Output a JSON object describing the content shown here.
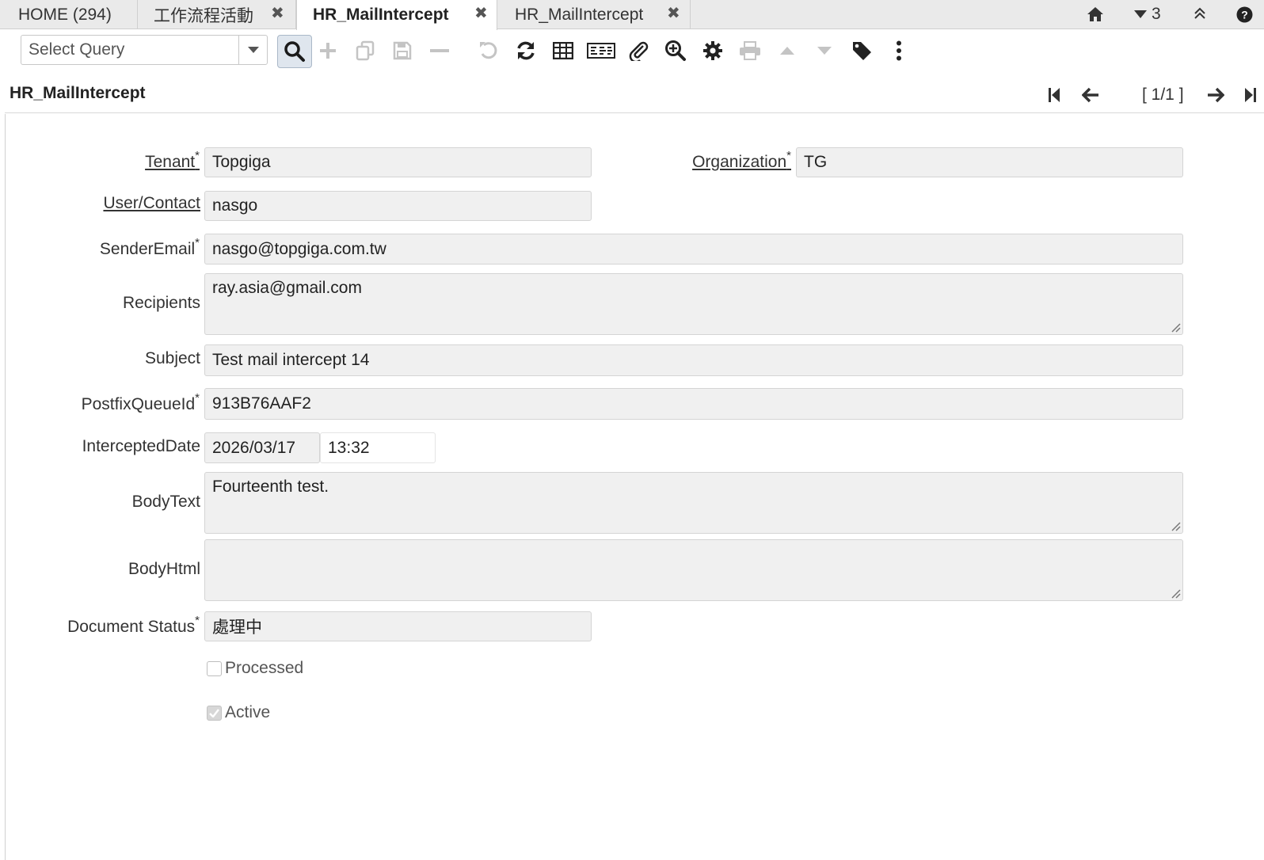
{
  "tabs": {
    "home": "HOME (294)",
    "workflow": "工作流程活動",
    "hr_active": "HR_MailIntercept",
    "hr_second": "HR_MailIntercept",
    "close_glyph": "✖"
  },
  "strip": {
    "window_count": "3",
    "icons": [
      "home-icon",
      "caret-down-icon",
      "double-chevron-up-icon",
      "help-icon"
    ]
  },
  "toolbar": {
    "select_query_placeholder": "Select Query",
    "icons": [
      "search-icon",
      "new-icon",
      "copy-icon",
      "save-icon",
      "delete-icon",
      "undo-icon",
      "refresh-icon",
      "grid-toggle-icon",
      "report-icon",
      "attachment-icon",
      "zoom-icon",
      "process-icon",
      "print-icon",
      "parent-record-icon",
      "detail-record-icon",
      "label-icon",
      "more-icon"
    ]
  },
  "titlebar": {
    "title": "HR_MailIntercept",
    "record_indicator": "[ 1/1 ]"
  },
  "form": {
    "tenant_label": "Tenant",
    "tenant_value": "Topgiga",
    "organization_label": "Organization",
    "organization_value": "TG",
    "user_label": "User/Contact",
    "user_value": "nasgo",
    "sender_label": "SenderEmail",
    "sender_value": "nasgo@topgiga.com.tw",
    "recipients_label": "Recipients",
    "recipients_value": "ray.asia@gmail.com",
    "subject_label": "Subject",
    "subject_value": "Test mail intercept 14",
    "queue_label": "PostfixQueueId",
    "queue_value": "913B76AAF2",
    "intercepted_label": "InterceptedDate",
    "intercepted_date": "2026/03/17",
    "intercepted_time": "13:32",
    "bodytext_label": "BodyText",
    "bodytext_value": "Fourteenth test.",
    "bodyhtml_label": "BodyHtml",
    "bodyhtml_value": "",
    "docstatus_label": "Document Status",
    "docstatus_value": "處理中",
    "processed_label": "Processed",
    "processed_checked": false,
    "active_label": "Active",
    "active_checked": true,
    "required_mark": "*"
  },
  "colors": {
    "field_bg": "#f0f0f0",
    "tabstrip_bg": "#eaeaea",
    "search_active_bg": "#dfe6ee"
  }
}
